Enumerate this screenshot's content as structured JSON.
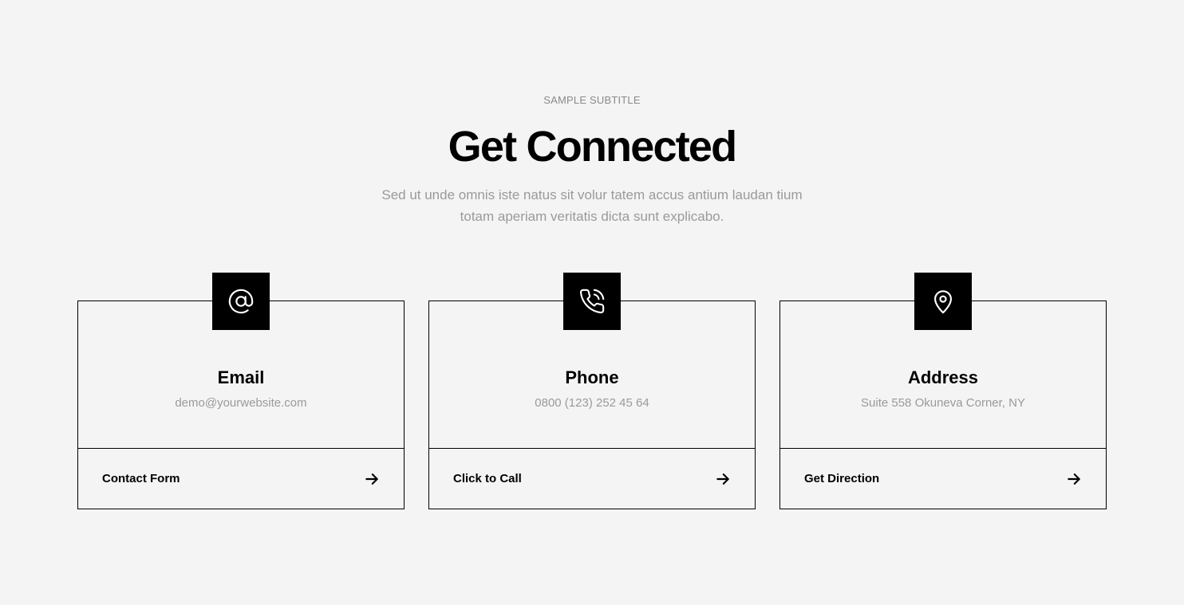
{
  "header": {
    "subtitle": "SAMPLE SUBTITLE",
    "title": "Get Connected",
    "description_line1": "Sed ut unde omnis iste natus sit volur tatem accus antium laudan tium",
    "description_line2": "totam aperiam veritatis dicta sunt explicabo."
  },
  "cards": [
    {
      "icon": "at-sign-icon",
      "heading": "Email",
      "detail": "demo@yourwebsite.com",
      "link_label": "Contact Form"
    },
    {
      "icon": "phone-icon",
      "heading": "Phone",
      "detail": "0800 (123) 252 45 64",
      "link_label": "Click to Call"
    },
    {
      "icon": "map-pin-icon",
      "heading": "Address",
      "detail": "Suite 558 Okuneva Corner, NY",
      "link_label": "Get Direction"
    }
  ],
  "colors": {
    "background": "#f4f4f4",
    "accent": "#000000",
    "muted_text": "#9a9a9a"
  }
}
